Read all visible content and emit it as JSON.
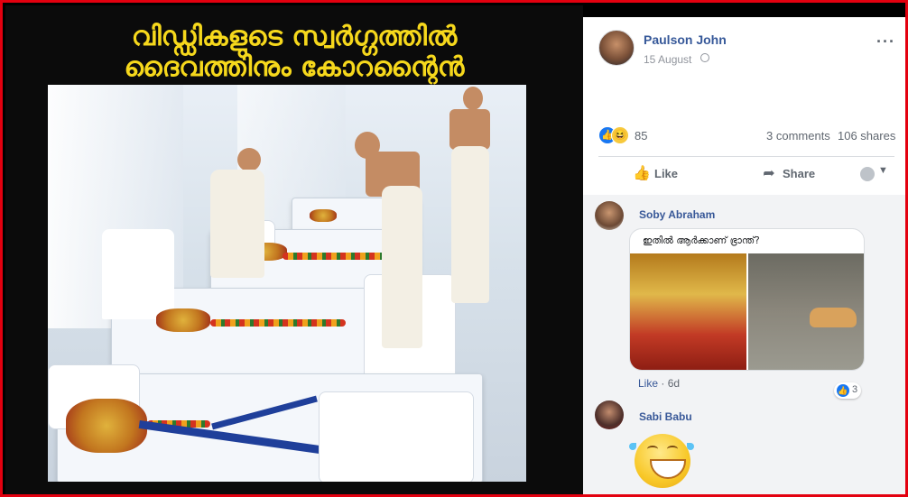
{
  "meme": {
    "caption_line1": "വിഡ്ഡികളുടെ സ്വർഗ്ഗത്തിൽ",
    "caption_line2": "ദൈവത്തിനും കോറന്റൈൻ"
  },
  "post": {
    "author": "Paulson John",
    "date": "15 August",
    "more_icon": "more-options-icon",
    "privacy_icon": "globe-icon"
  },
  "stats": {
    "reaction_count": "85",
    "comments": "3 comments",
    "shares": "106 shares",
    "reaction_icons": [
      "like-reaction-icon",
      "haha-reaction-icon"
    ]
  },
  "actions": {
    "like": "Like",
    "share": "Share"
  },
  "comments": [
    {
      "name": "Soby Abraham",
      "image_text": "ഇതിൽ ആർക്കാണ് ഭ്രാന്ത്?",
      "like_link": "Like",
      "time": "6d",
      "like_count": "3"
    },
    {
      "name": "Sabi Babu",
      "sticker": "laughing-emoji-sticker"
    }
  ],
  "colors": {
    "frame": "#e3000f",
    "caption": "#f6d81c",
    "link": "#365899",
    "like_blue": "#1877f2"
  }
}
